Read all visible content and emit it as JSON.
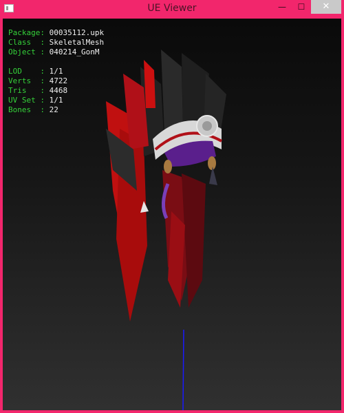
{
  "window": {
    "title": "UE Viewer",
    "controls": {
      "minimize": "—",
      "maximize": "☐",
      "close": "✕"
    }
  },
  "info": {
    "group1": [
      {
        "label": "Package:",
        "value": "00035112.upk"
      },
      {
        "label": "Class  :",
        "value": "SkeletalMesh"
      },
      {
        "label": "Object :",
        "value": "040214_GonM"
      }
    ],
    "group2": [
      {
        "label": "LOD    :",
        "value": "1/1"
      },
      {
        "label": "Verts  :",
        "value": "4722"
      },
      {
        "label": "Tris   :",
        "value": "4468"
      },
      {
        "label": "UV Set :",
        "value": "1/1"
      },
      {
        "label": "Bones  :",
        "value": "22"
      }
    ]
  },
  "colors": {
    "title_bar": "#f2266c",
    "label": "#35d23a",
    "value": "#f0f0f0",
    "axis": "#1a1aff"
  }
}
